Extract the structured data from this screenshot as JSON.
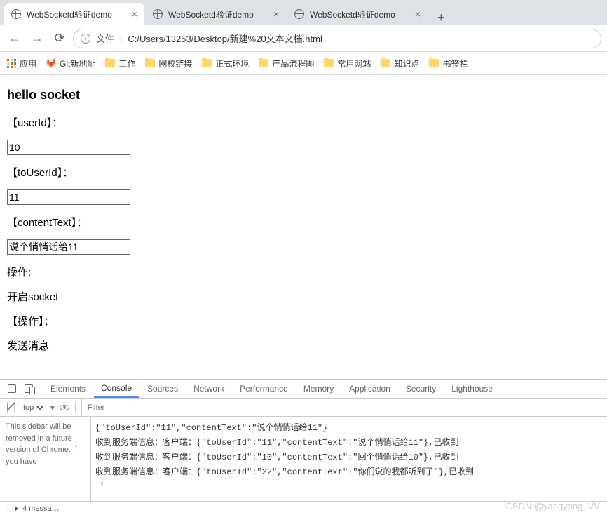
{
  "tabs": [
    {
      "title": "WebSocketd验证demo"
    },
    {
      "title": "WebSocketd验证demo"
    },
    {
      "title": "WebSocketd验证demo"
    }
  ],
  "addr": {
    "file_label": "文件",
    "url": "C:/Users/13253/Desktop/新建%20文本文档.html"
  },
  "bookmarks": {
    "apps": "应用",
    "items": [
      "Git新地址",
      "工作",
      "网校链接",
      "正式环境",
      "产品流程图",
      "常用网站",
      "知识点",
      "书签栏"
    ]
  },
  "page": {
    "heading": "hello socket",
    "labels": {
      "userId": "【userId】：",
      "toUserId": "【toUserId】：",
      "contentText": "【contentText】：",
      "op1": "操作:",
      "open": "开启socket",
      "op2": "【操作】：",
      "send": "发送消息"
    },
    "fields": {
      "userId": "10",
      "toUserId": "11",
      "contentText": "说个悄悄话给11"
    }
  },
  "devtools": {
    "tabs": [
      "Elements",
      "Console",
      "Sources",
      "Network",
      "Performance",
      "Memory",
      "Application",
      "Security",
      "Lighthouse"
    ],
    "active_tab": "Console",
    "context": "top",
    "filter_placeholder": "Filter",
    "sidebar": "This sidebar will be removed in a future version of Chrome. If you have",
    "lines": [
      "{\"toUserId\":\"11\",\"contentText\":\"说个悄悄话给11\"}",
      "收到服务端信息：客户端：{\"toUserId\":\"11\",\"contentText\":\"说个悄悄话给11\"},已收到",
      "收到服务端信息：客户端：{\"toUserId\":\"10\",\"contentText\":\"回个悄悄话给10\"},已收到",
      "收到服务端信息：客户端：{\"toUserId\":\"22\",\"contentText\":\"你们说的我都听到了\"},已收到"
    ],
    "footer_msg": "4 messa…"
  },
  "watermark": "CSDN @yangyang_VV"
}
